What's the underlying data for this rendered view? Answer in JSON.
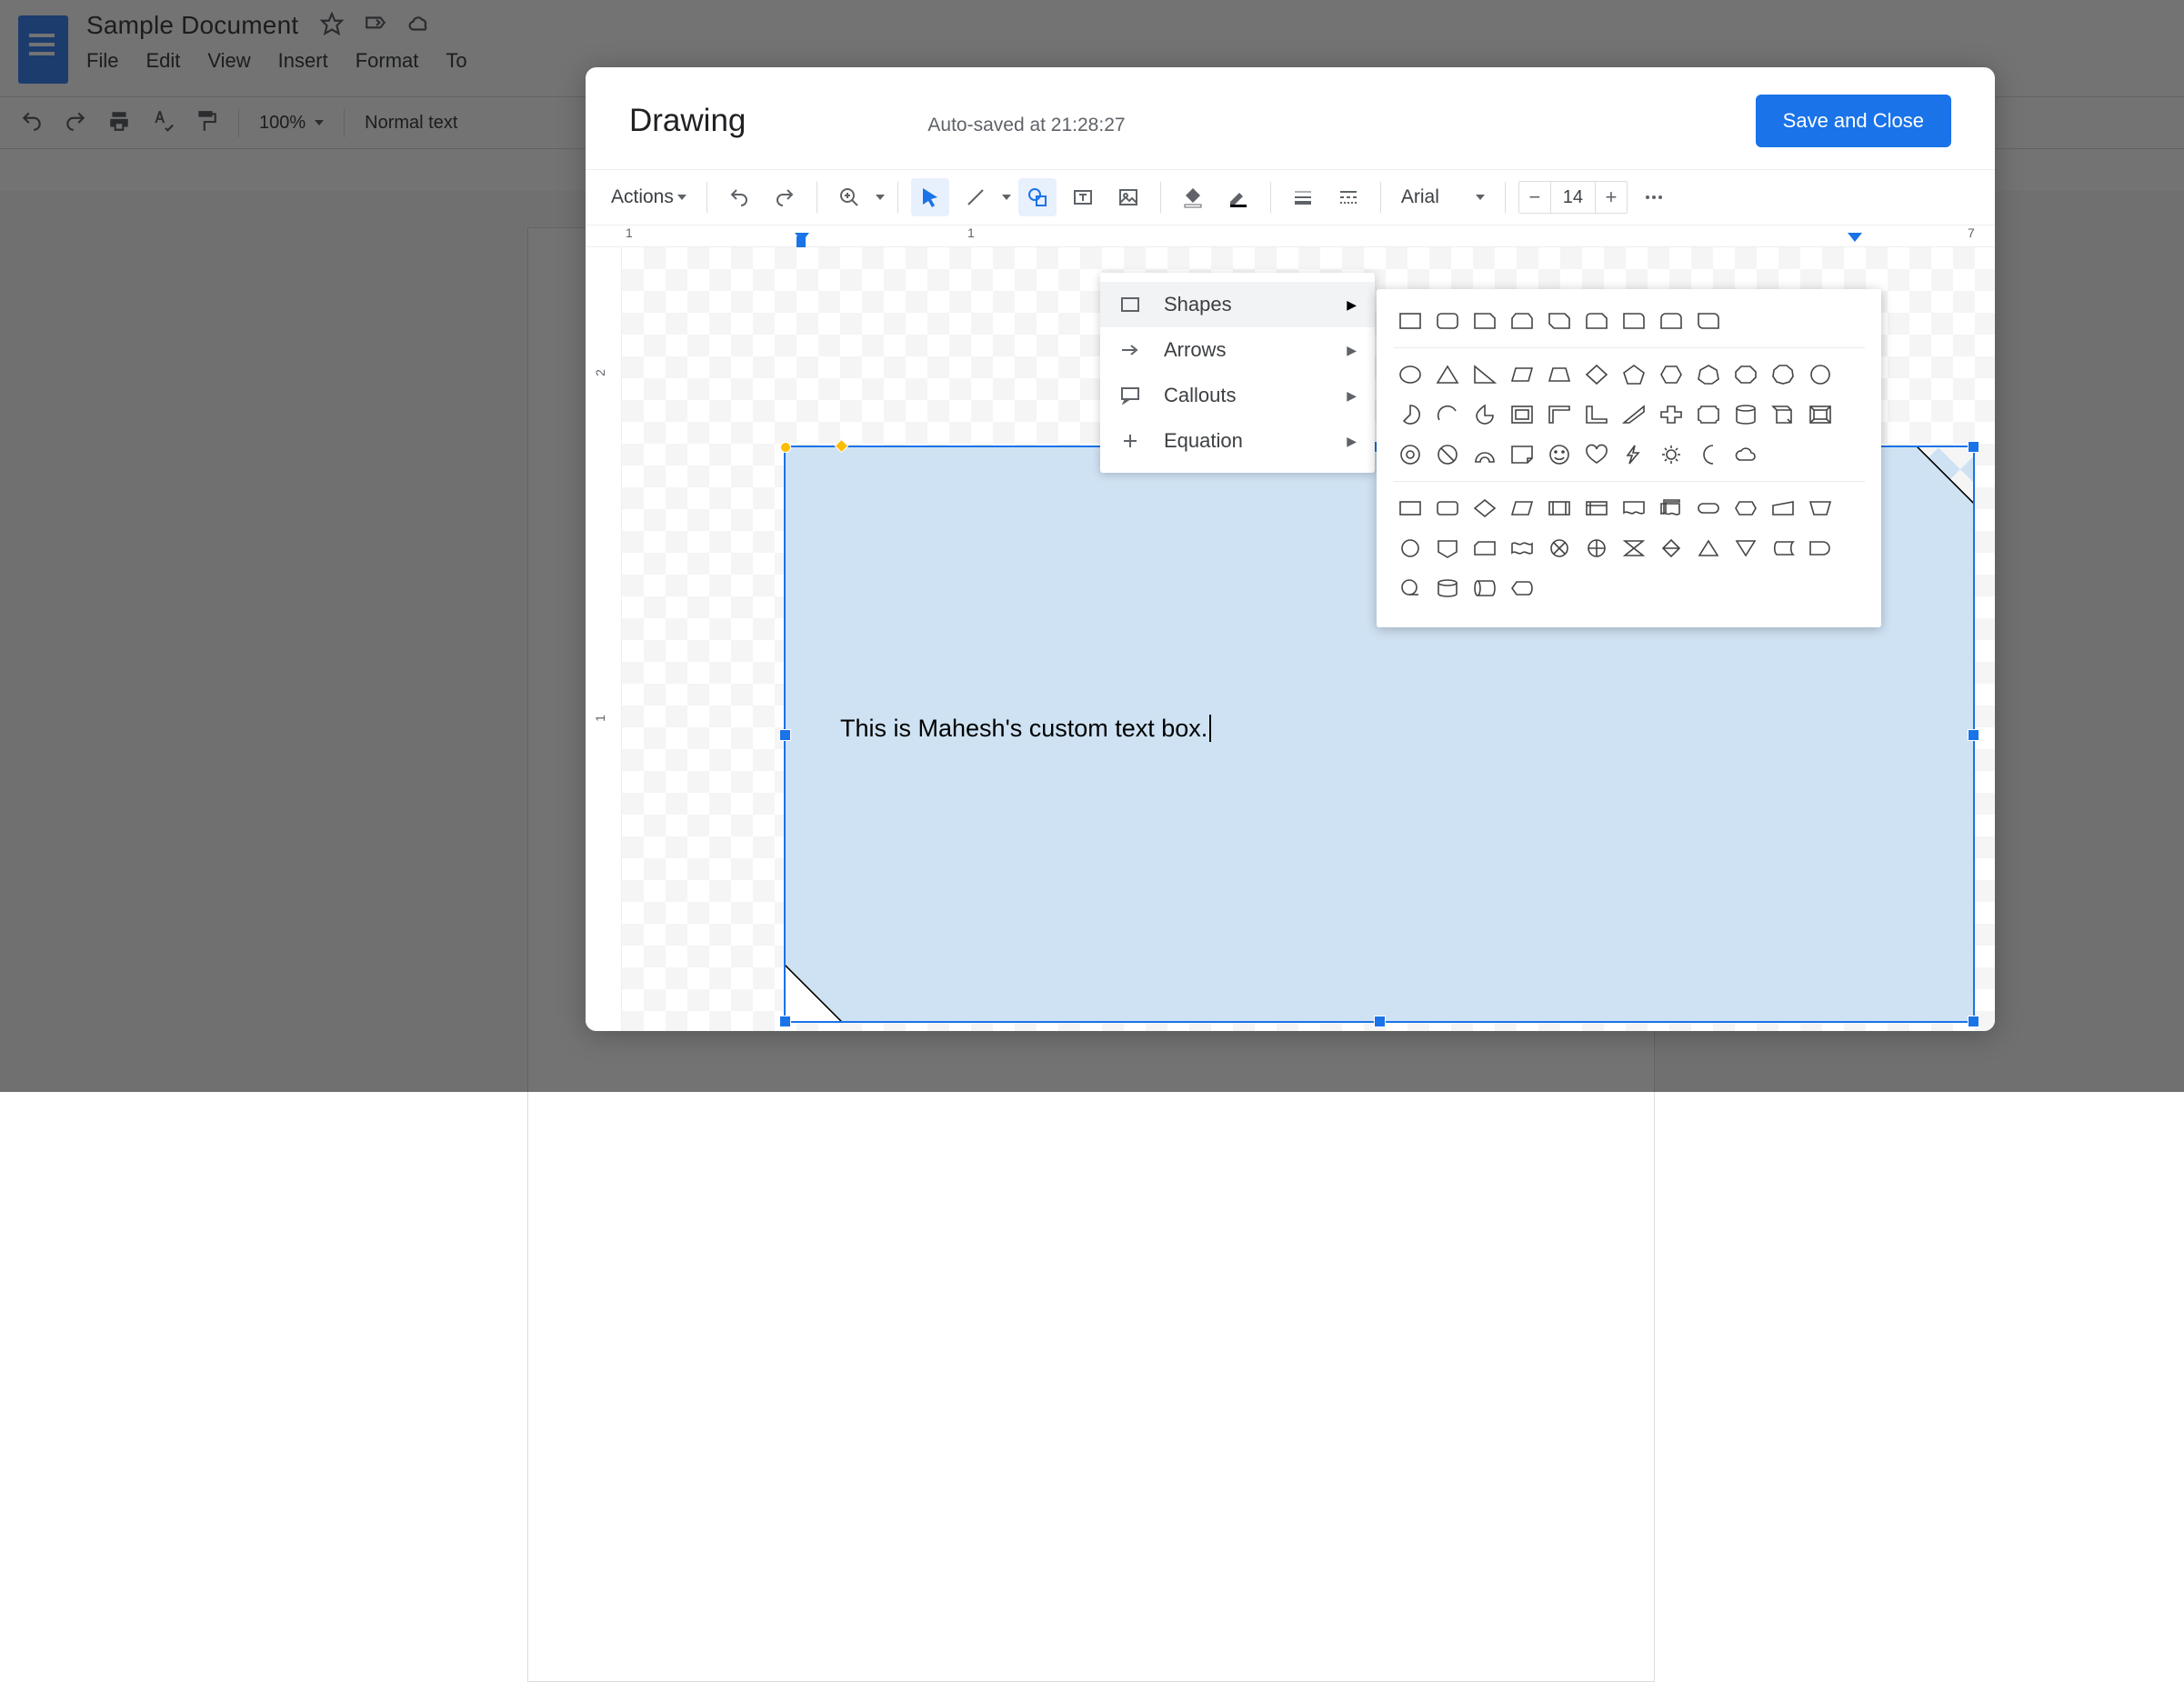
{
  "docs": {
    "title": "Sample Document",
    "menu": {
      "file": "File",
      "edit": "Edit",
      "view": "View",
      "insert": "Insert",
      "format": "Format",
      "tools": "To"
    },
    "toolbar": {
      "zoom": "100%",
      "style": "Normal text"
    }
  },
  "drawing": {
    "title": "Drawing",
    "status": "Auto-saved at 21:28:27",
    "save_label": "Save and Close",
    "toolbar": {
      "actions": "Actions",
      "font": "Arial",
      "size": "14"
    },
    "ruler": {
      "marks": [
        "1",
        "1",
        "7"
      ]
    },
    "vruler": {
      "marks": [
        "2",
        "1"
      ]
    },
    "shape_text": "This is Mahesh's custom text box.",
    "menu": {
      "shapes": "Shapes",
      "arrows": "Arrows",
      "callouts": "Callouts",
      "equation": "Equation"
    }
  }
}
